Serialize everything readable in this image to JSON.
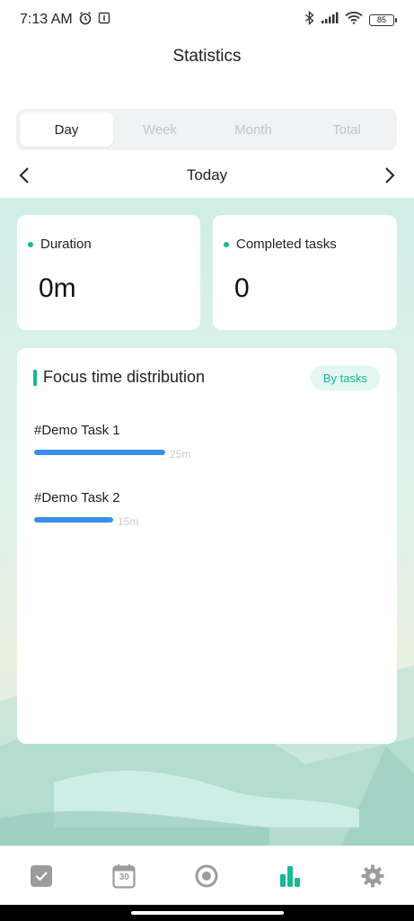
{
  "status_bar": {
    "time": "7:13 AM",
    "battery": "85"
  },
  "header": {
    "title": "Statistics"
  },
  "tabs": [
    {
      "label": "Day",
      "active": true
    },
    {
      "label": "Week",
      "active": false
    },
    {
      "label": "Month",
      "active": false
    },
    {
      "label": "Total",
      "active": false
    }
  ],
  "date_nav": {
    "label": "Today",
    "prev_icon": "chevron-left-icon",
    "next_icon": "chevron-right-icon"
  },
  "stats": {
    "duration": {
      "label": "Duration",
      "value": "0m"
    },
    "completed": {
      "label": "Completed tasks",
      "value": "0"
    }
  },
  "distribution": {
    "title": "Focus time distribution",
    "toggle_label": "By tasks",
    "tasks": [
      {
        "name": "#Demo Task 1",
        "time": "25m",
        "minutes": 25
      },
      {
        "name": "#Demo Task 2",
        "time": "15m",
        "minutes": 15
      }
    ]
  },
  "bottom_nav": [
    {
      "name": "tasks",
      "icon": "checkbox-icon",
      "active": false
    },
    {
      "name": "calendar",
      "icon": "calendar-icon",
      "calendar_day": "30",
      "active": false
    },
    {
      "name": "focus",
      "icon": "target-icon",
      "active": false
    },
    {
      "name": "statistics",
      "icon": "bar-chart-icon",
      "active": true
    },
    {
      "name": "settings",
      "icon": "gear-icon",
      "active": false
    }
  ],
  "colors": {
    "accent": "#17b897",
    "bar": "#3a8ee6",
    "inactive_icon": "#9a9c9e"
  }
}
